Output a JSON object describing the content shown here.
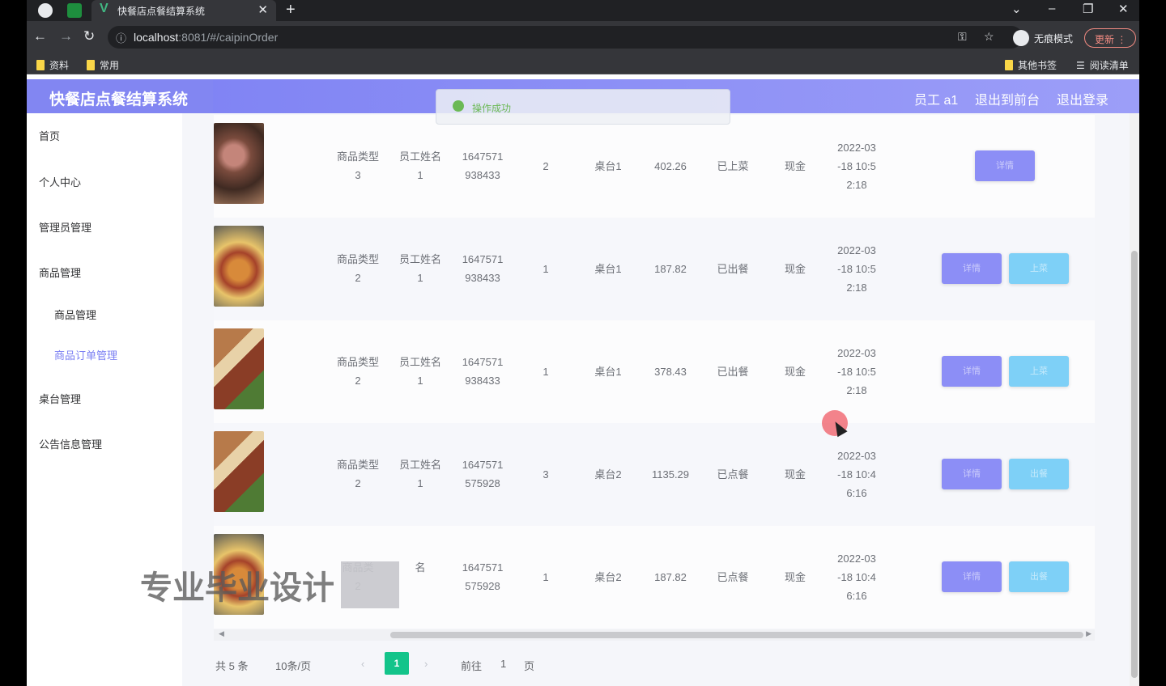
{
  "browser": {
    "tab_title": "快餐店点餐结算系统",
    "url_host": "localhost",
    "url_rest": ":8081/#/caipinOrder",
    "incognito_label": "无痕模式",
    "update_label": "更新",
    "bookmarks": [
      "资料",
      "常用"
    ],
    "bookmarks_right": [
      "其他书签",
      "阅读清单"
    ]
  },
  "header": {
    "title": "快餐店点餐结算系统",
    "user": "员工 a1",
    "back_to_front": "退出到前台",
    "logout": "退出登录"
  },
  "toast": {
    "text": "操作成功"
  },
  "sidebar": {
    "items": [
      {
        "label": "首页"
      },
      {
        "label": "个人中心"
      },
      {
        "label": "管理员管理"
      },
      {
        "label": "商品管理"
      },
      {
        "label": "商品管理"
      },
      {
        "label": "商品订单管理"
      },
      {
        "label": "桌台管理"
      },
      {
        "label": "公告信息管理"
      }
    ]
  },
  "rows": [
    {
      "type1": "商品类型",
      "type2": "3",
      "emp1": "员工姓名",
      "emp2": "1",
      "no1": "1647571",
      "no2": "938433",
      "qty": "2",
      "table": "桌台1",
      "price": "402.26",
      "status": "已上菜",
      "pay": "现金",
      "t1": "2022-03",
      "t2": "-18 10:5",
      "t3": "2:18",
      "btn1": "详情",
      "btn2": ""
    },
    {
      "type1": "商品类型",
      "type2": "2",
      "emp1": "员工姓名",
      "emp2": "1",
      "no1": "1647571",
      "no2": "938433",
      "qty": "1",
      "table": "桌台1",
      "price": "187.82",
      "status": "已出餐",
      "pay": "现金",
      "t1": "2022-03",
      "t2": "-18 10:5",
      "t3": "2:18",
      "btn1": "详情",
      "btn2": "上菜"
    },
    {
      "type1": "商品类型",
      "type2": "2",
      "emp1": "员工姓名",
      "emp2": "1",
      "no1": "1647571",
      "no2": "938433",
      "qty": "1",
      "table": "桌台1",
      "price": "378.43",
      "status": "已出餐",
      "pay": "现金",
      "t1": "2022-03",
      "t2": "-18 10:5",
      "t3": "2:18",
      "btn1": "详情",
      "btn2": "上菜"
    },
    {
      "type1": "商品类型",
      "type2": "2",
      "emp1": "员工姓名",
      "emp2": "1",
      "no1": "1647571",
      "no2": "575928",
      "qty": "3",
      "table": "桌台2",
      "price": "1135.29",
      "status": "已点餐",
      "pay": "现金",
      "t1": "2022-03",
      "t2": "-18 10:4",
      "t3": "6:16",
      "btn1": "详情",
      "btn2": "出餐"
    },
    {
      "type1": "商品类",
      "type2": "2",
      "emp1": "名",
      "emp2": "",
      "no1": "1647571",
      "no2": "575928",
      "qty": "1",
      "table": "桌台2",
      "price": "187.82",
      "status": "已点餐",
      "pay": "现金",
      "t1": "2022-03",
      "t2": "-18 10:4",
      "t3": "6:16",
      "btn1": "详情",
      "btn2": "出餐"
    }
  ],
  "pager": {
    "total": "共 5 条",
    "per_page": "10条/页",
    "current": "1",
    "goto": "前往",
    "goto_value": "1",
    "page_unit": "页"
  },
  "watermark": "专业毕业设计",
  "colors": {
    "accent": "#7b7ff3",
    "button_purple": "#8c8ef6",
    "button_cyan": "#7ed0f7",
    "page_active": "#13c48a",
    "toast_green": "#67c23a"
  }
}
